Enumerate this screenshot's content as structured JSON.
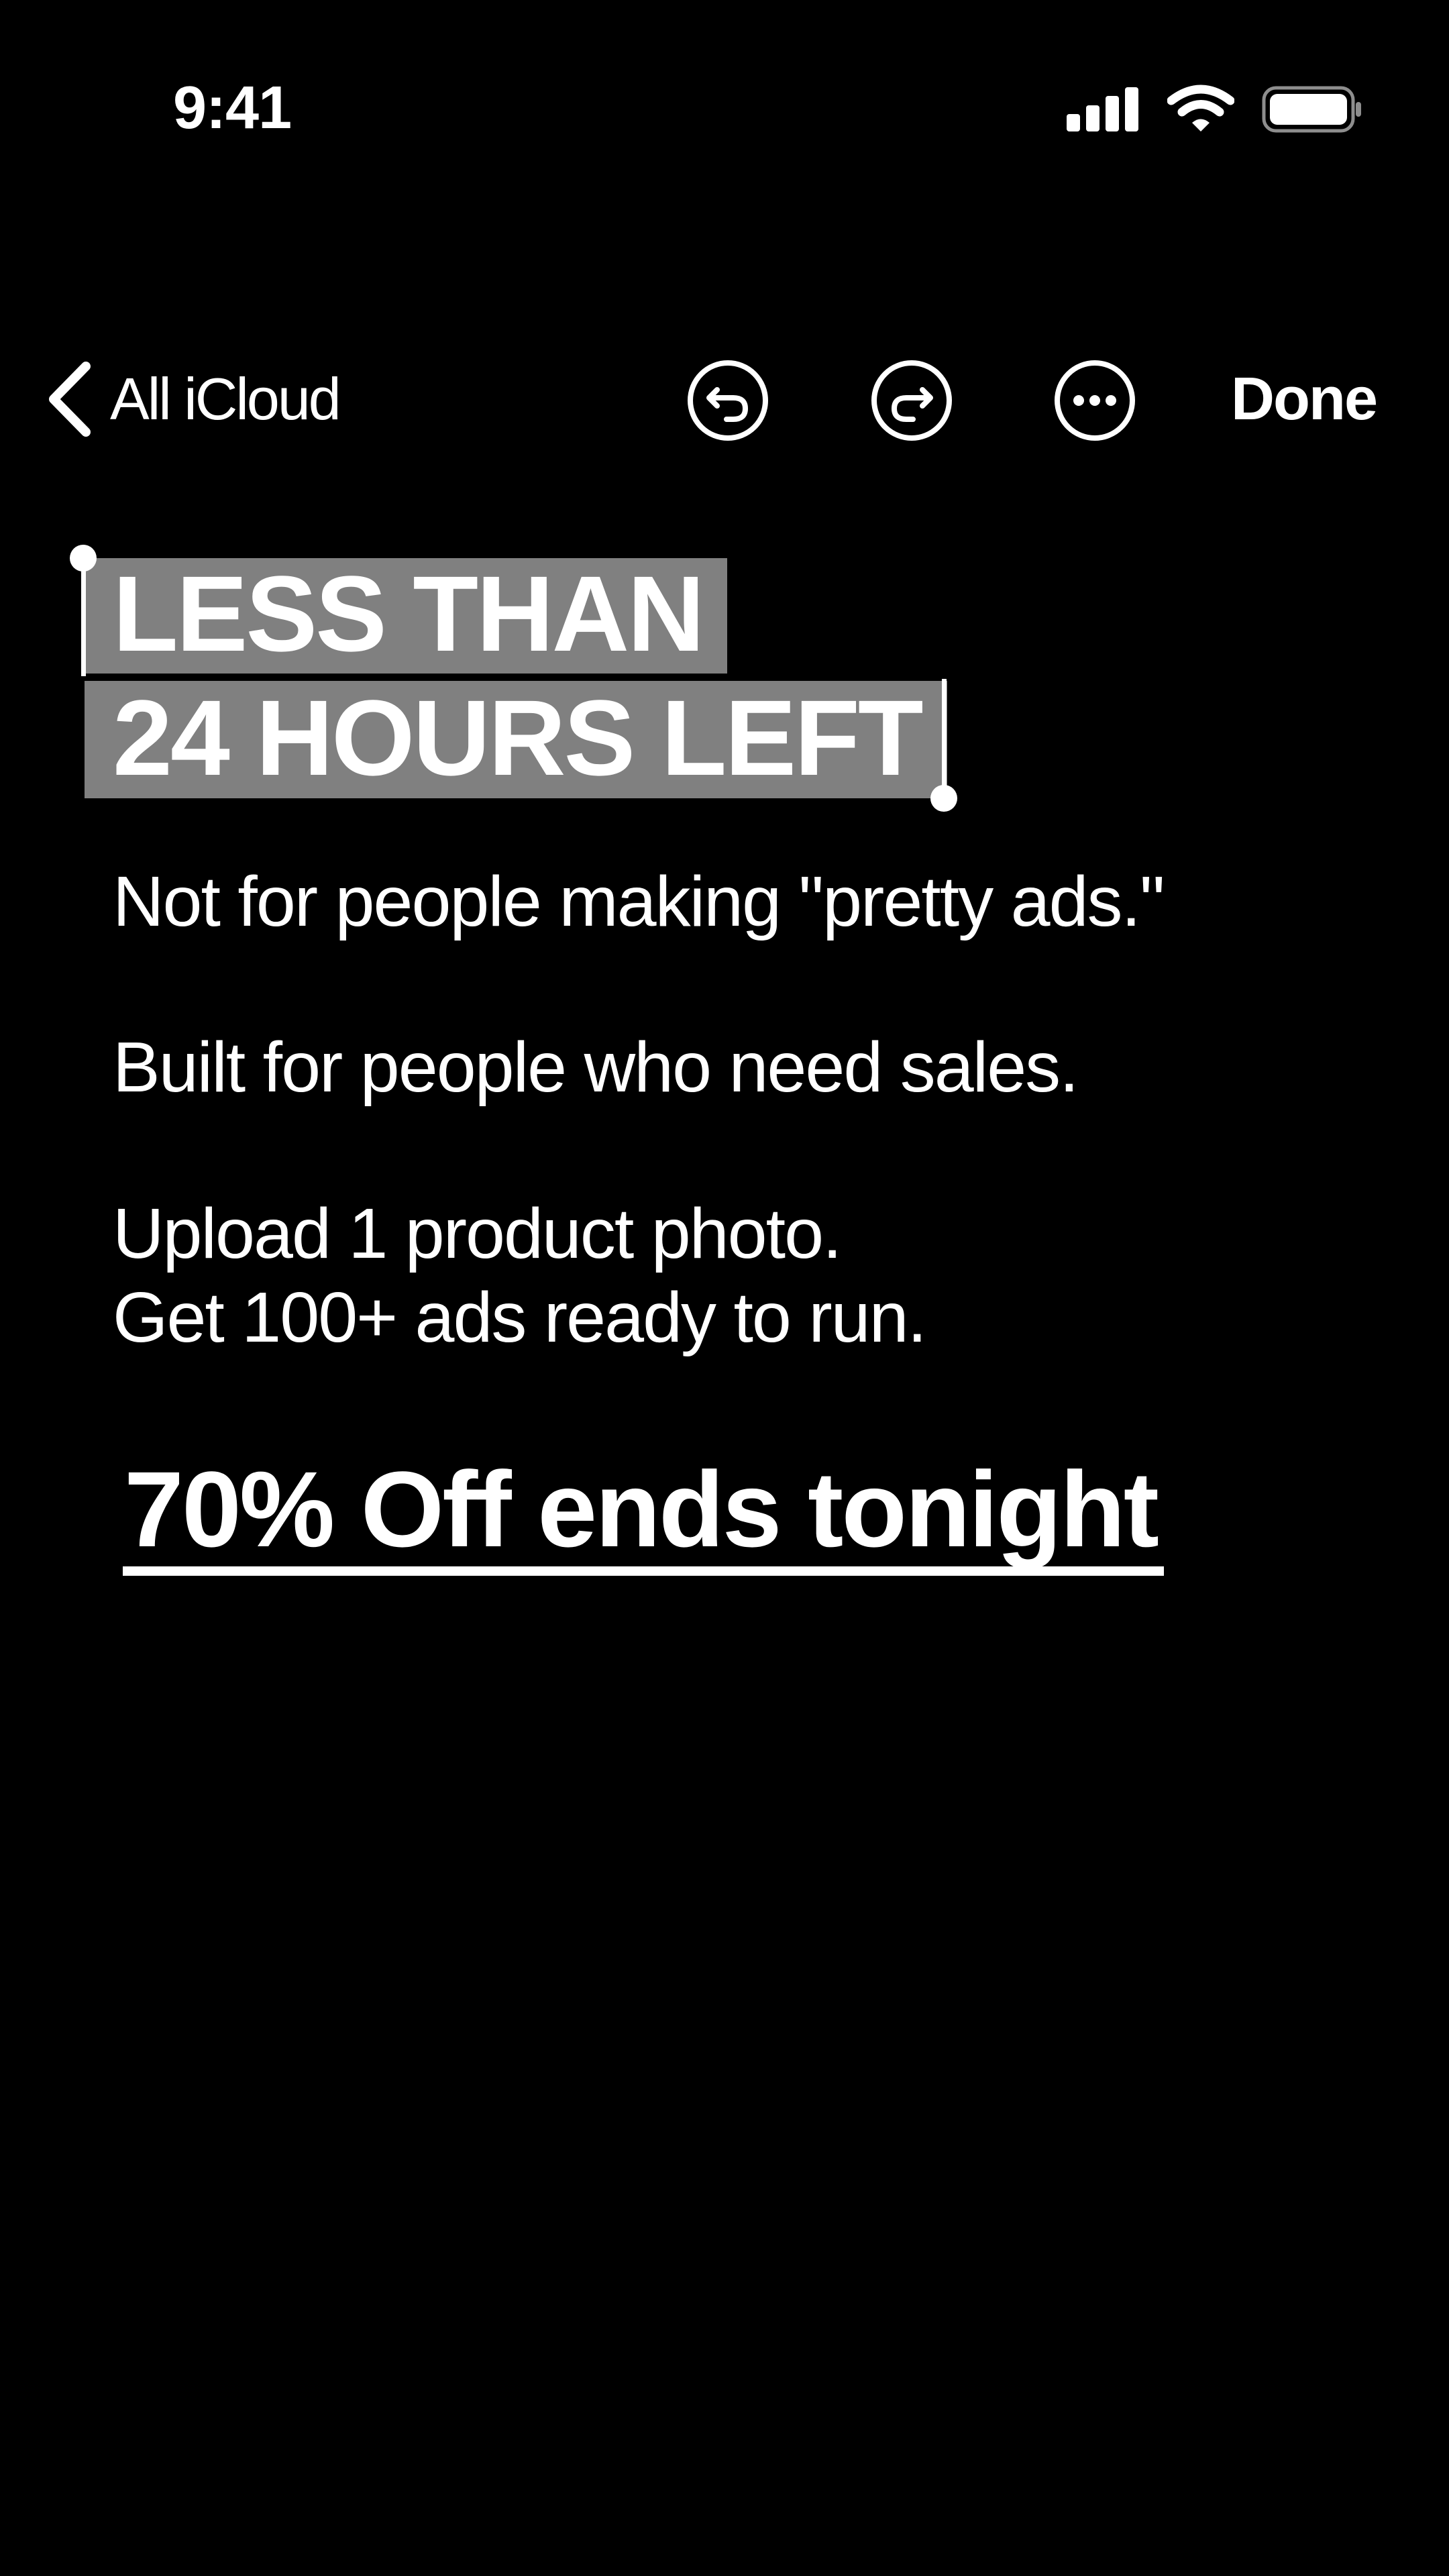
{
  "status_bar": {
    "time": "9:41",
    "icons": [
      "cellular-signal-icon",
      "wifi-icon",
      "battery-icon"
    ]
  },
  "nav": {
    "back_label": "All iCloud",
    "done_label": "Done",
    "icons": [
      "chevron-left-icon",
      "undo-icon",
      "redo-icon",
      "more-icon"
    ]
  },
  "note": {
    "heading_lines": [
      "LESS THAN",
      "24 HOURS LEFT"
    ],
    "body_lines": [
      "Not for people making \"pretty ads.\"",
      "Built for people who need sales.",
      "Upload 1 product photo.",
      "Get 100+ ads ready to run."
    ],
    "cta": "70% Off ends tonight"
  },
  "colors": {
    "background": "#000000",
    "text": "#ffffff",
    "selection": "#808080"
  }
}
